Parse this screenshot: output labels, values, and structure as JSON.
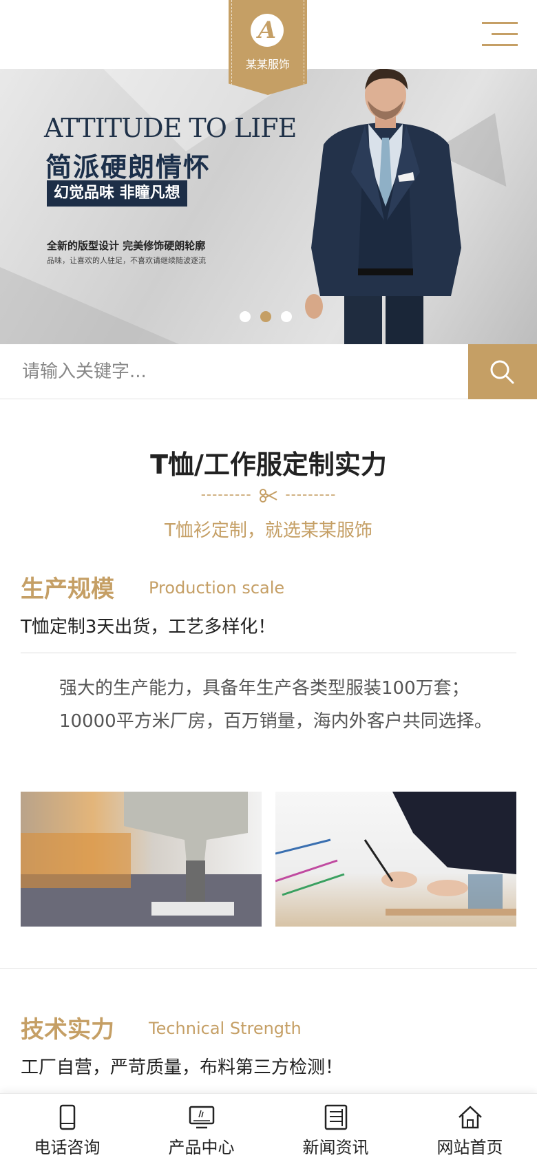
{
  "header": {
    "logo_letter": "A",
    "logo_text": "某某服饰",
    "menu_icon": "hamburger-menu-icon",
    "accent_color": "#c59f65"
  },
  "banner": {
    "title_en": "ATTITUDE TO LIFE",
    "slogan": "简派硬朗情怀",
    "tag": "幻觉品味 非瞳凡想",
    "sub1": "全新的版型设计 完美修饰硬朗轮廓",
    "sub2": "品味，让喜欢的人驻足，不喜欢请继续随波逐流",
    "slides": 3,
    "active_slide": 2
  },
  "search": {
    "placeholder": "请输入关键字...",
    "button_icon": "search-icon"
  },
  "section": {
    "title": "T恤/工作服定制实力",
    "divider_left": "---------",
    "divider_right": "---------",
    "subtitle": "T恤衫定制，就选某某服饰"
  },
  "production": {
    "title": "生产规模",
    "title_en": "Production scale",
    "desc": "T恤定制3天出货，工艺多样化！",
    "para": "强大的生产能力，具备年生产各类型服装100万套；10000平方米厂房，百万销量，海内外客户共同选择。"
  },
  "technical": {
    "title": "技术实力",
    "title_en": "Technical Strength",
    "desc": "工厂自营，严苛质量，布料第三方检测！"
  },
  "bottom_nav": [
    {
      "label": "电话咨询",
      "icon": "phone-icon"
    },
    {
      "label": "产品中心",
      "icon": "monitor-icon"
    },
    {
      "label": "新闻资讯",
      "icon": "news-icon"
    },
    {
      "label": "网站首页",
      "icon": "home-icon"
    }
  ]
}
